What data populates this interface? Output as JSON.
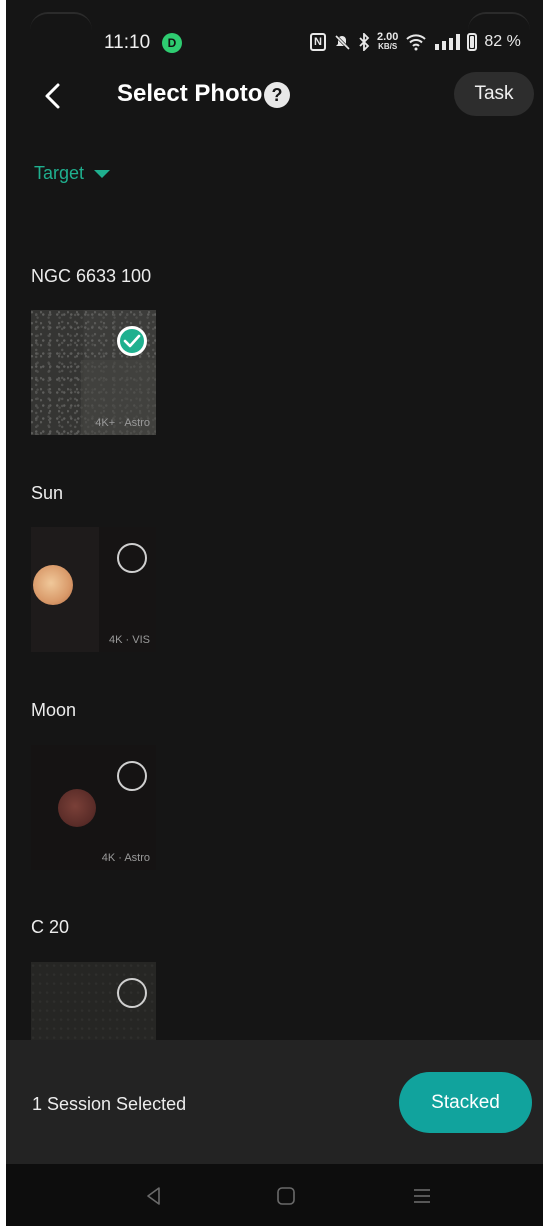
{
  "status_bar": {
    "time": "11:10",
    "app_indicator": "D",
    "nfc": "N",
    "net_speed_value": "2.00",
    "net_speed_unit": "KB/S",
    "battery_percent": "82 %"
  },
  "header": {
    "title": "Select Photo",
    "help_glyph": "?",
    "task_label": "Task"
  },
  "filter": {
    "label": "Target"
  },
  "sessions": [
    {
      "title": "NGC 6633 100",
      "label": "4K+ · Astro",
      "selected": true
    },
    {
      "title": "Sun",
      "label": "4K · VIS",
      "selected": false
    },
    {
      "title": "Moon",
      "label": "4K · Astro",
      "selected": false
    },
    {
      "title": "C 20",
      "label": "",
      "selected": false
    }
  ],
  "footer": {
    "selection_text": "1 Session Selected",
    "stacked_label": "Stacked"
  },
  "colors": {
    "accent": "#1fb08f",
    "button_teal": "#11a39d",
    "background": "#151515"
  }
}
